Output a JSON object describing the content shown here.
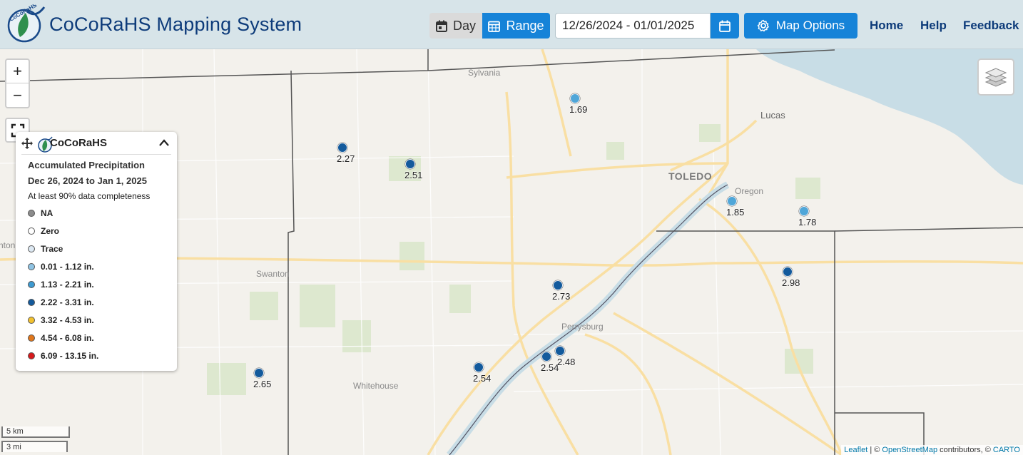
{
  "header": {
    "logo_text": "CoCoRaHS",
    "title": "CoCoRaHS Mapping System",
    "mode_day_label": "Day",
    "mode_range_label": "Range",
    "date_range_value": "12/26/2024 - 01/01/2025",
    "map_options_label": "Map Options",
    "nav": {
      "home": "Home",
      "help": "Help",
      "feedback": "Feedback"
    }
  },
  "controls": {
    "zoom_in": "+",
    "zoom_out": "−"
  },
  "legend": {
    "title": "CoCoRaHS",
    "line1": "Accumulated Precipitation",
    "line2": "Dec 26, 2024 to Jan 1, 2025",
    "line3": "At least 90% data completeness",
    "items": [
      {
        "label": "NA",
        "color": "#8c8c8c"
      },
      {
        "label": "Zero",
        "color": "#ffffff"
      },
      {
        "label": "Trace",
        "color": "#dde9f3"
      },
      {
        "label": "0.01 - 1.12 in.",
        "color": "#8fc3e3"
      },
      {
        "label": "1.13 - 2.21 in.",
        "color": "#3d9ad1"
      },
      {
        "label": "2.22 - 3.31 in.",
        "color": "#135a9c"
      },
      {
        "label": "3.32 - 4.53 in.",
        "color": "#f2c12e"
      },
      {
        "label": "4.54 - 6.08 in.",
        "color": "#e0761b"
      },
      {
        "label": "6.09 - 13.15 in.",
        "color": "#d7191c"
      }
    ]
  },
  "map_labels": {
    "sylvania": "Sylvania",
    "lucas": "Lucas",
    "toledo": "TOLEDO",
    "oregon": "Oregon",
    "swanton": "Swanton",
    "perrysburg": "Perrysburg",
    "whitehouse": "Whitehouse",
    "partial_left": "nton"
  },
  "stations": [
    {
      "value": "1.69",
      "color": "#4fa6d8"
    },
    {
      "value": "2.27",
      "color": "#135a9c"
    },
    {
      "value": "2.51",
      "color": "#135a9c"
    },
    {
      "value": "1.85",
      "color": "#4fa6d8"
    },
    {
      "value": "1.78",
      "color": "#4fa6d8"
    },
    {
      "value": "2.98",
      "color": "#135a9c"
    },
    {
      "value": "2.73",
      "color": "#135a9c"
    },
    {
      "value": "2.54",
      "color": "#135a9c"
    },
    {
      "value": "2.54",
      "color": "#135a9c"
    },
    {
      "value": "2.48",
      "color": "#135a9c"
    },
    {
      "value": "2.65",
      "color": "#135a9c"
    }
  ],
  "scale": {
    "km": "5 km",
    "mi": "3 mi"
  },
  "attribution": {
    "leaflet": "Leaflet",
    "sep1": " | © ",
    "osm": "OpenStreetMap",
    "mid": " contributors, © ",
    "carto": "CARTO"
  }
}
